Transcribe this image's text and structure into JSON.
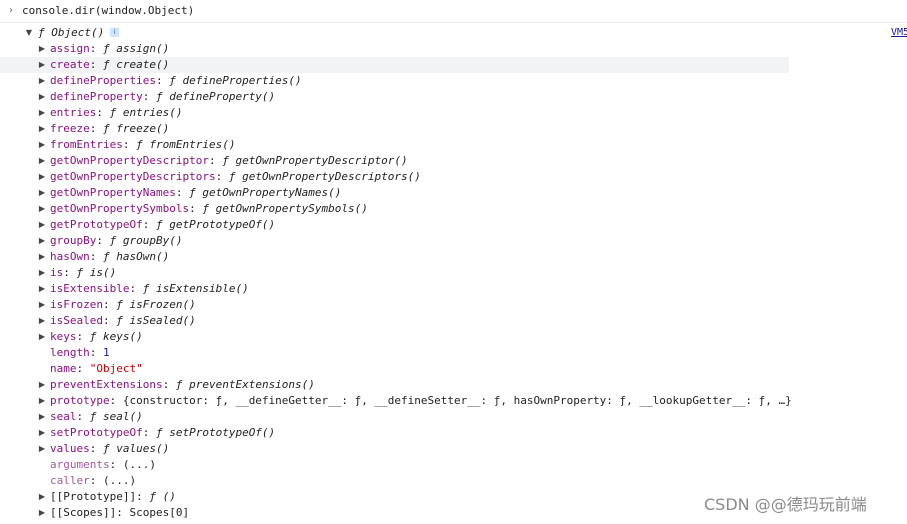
{
  "command": {
    "prompt_icon": "chevron-right-icon",
    "text": "console.dir(window.Object)"
  },
  "source_link": "VM5",
  "root": {
    "expand_icon": "triangle-down-icon",
    "f": "ƒ",
    "name": "Object()",
    "info_icon": "i"
  },
  "entries": [
    {
      "key": "assign",
      "kind": "fn",
      "f": "ƒ",
      "value": "assign()",
      "expandable": true,
      "dim": false
    },
    {
      "key": "create",
      "kind": "fn",
      "f": "ƒ",
      "value": "create()",
      "expandable": true,
      "dim": false,
      "hover": true
    },
    {
      "key": "defineProperties",
      "kind": "fn",
      "f": "ƒ",
      "value": "defineProperties()",
      "expandable": true,
      "dim": false
    },
    {
      "key": "defineProperty",
      "kind": "fn",
      "f": "ƒ",
      "value": "defineProperty()",
      "expandable": true,
      "dim": false
    },
    {
      "key": "entries",
      "kind": "fn",
      "f": "ƒ",
      "value": "entries()",
      "expandable": true,
      "dim": false
    },
    {
      "key": "freeze",
      "kind": "fn",
      "f": "ƒ",
      "value": "freeze()",
      "expandable": true,
      "dim": false
    },
    {
      "key": "fromEntries",
      "kind": "fn",
      "f": "ƒ",
      "value": "fromEntries()",
      "expandable": true,
      "dim": false
    },
    {
      "key": "getOwnPropertyDescriptor",
      "kind": "fn",
      "f": "ƒ",
      "value": "getOwnPropertyDescriptor()",
      "expandable": true,
      "dim": false
    },
    {
      "key": "getOwnPropertyDescriptors",
      "kind": "fn",
      "f": "ƒ",
      "value": "getOwnPropertyDescriptors()",
      "expandable": true,
      "dim": false
    },
    {
      "key": "getOwnPropertyNames",
      "kind": "fn",
      "f": "ƒ",
      "value": "getOwnPropertyNames()",
      "expandable": true,
      "dim": false
    },
    {
      "key": "getOwnPropertySymbols",
      "kind": "fn",
      "f": "ƒ",
      "value": "getOwnPropertySymbols()",
      "expandable": true,
      "dim": false
    },
    {
      "key": "getPrototypeOf",
      "kind": "fn",
      "f": "ƒ",
      "value": "getPrototypeOf()",
      "expandable": true,
      "dim": false
    },
    {
      "key": "groupBy",
      "kind": "fn",
      "f": "ƒ",
      "value": "groupBy()",
      "expandable": true,
      "dim": false
    },
    {
      "key": "hasOwn",
      "kind": "fn",
      "f": "ƒ",
      "value": "hasOwn()",
      "expandable": true,
      "dim": false
    },
    {
      "key": "is",
      "kind": "fn",
      "f": "ƒ",
      "value": "is()",
      "expandable": true,
      "dim": false
    },
    {
      "key": "isExtensible",
      "kind": "fn",
      "f": "ƒ",
      "value": "isExtensible()",
      "expandable": true,
      "dim": false
    },
    {
      "key": "isFrozen",
      "kind": "fn",
      "f": "ƒ",
      "value": "isFrozen()",
      "expandable": true,
      "dim": false
    },
    {
      "key": "isSealed",
      "kind": "fn",
      "f": "ƒ",
      "value": "isSealed()",
      "expandable": true,
      "dim": false
    },
    {
      "key": "keys",
      "kind": "fn",
      "f": "ƒ",
      "value": "keys()",
      "expandable": true,
      "dim": false
    },
    {
      "key": "length",
      "kind": "num",
      "value": "1",
      "expandable": false,
      "dim": false
    },
    {
      "key": "name",
      "kind": "str",
      "value": "\"Object\"",
      "expandable": false,
      "dim": false
    },
    {
      "key": "preventExtensions",
      "kind": "fn",
      "f": "ƒ",
      "value": "preventExtensions()",
      "expandable": true,
      "dim": false
    },
    {
      "key": "prototype",
      "kind": "plain",
      "value": "{constructor: ƒ, __defineGetter__: ƒ, __defineSetter__: ƒ, hasOwnProperty: ƒ, __lookupGetter__: ƒ, …}",
      "expandable": true,
      "dim": false
    },
    {
      "key": "seal",
      "kind": "fn",
      "f": "ƒ",
      "value": "seal()",
      "expandable": true,
      "dim": false
    },
    {
      "key": "setPrototypeOf",
      "kind": "fn",
      "f": "ƒ",
      "value": "setPrototypeOf()",
      "expandable": true,
      "dim": false
    },
    {
      "key": "values",
      "kind": "fn",
      "f": "ƒ",
      "value": "values()",
      "expandable": true,
      "dim": false
    },
    {
      "key": "arguments",
      "kind": "plain",
      "value": "(...)",
      "expandable": false,
      "dim": true
    },
    {
      "key": "caller",
      "kind": "plain",
      "value": "(...)",
      "expandable": false,
      "dim": true
    },
    {
      "key": "[[Prototype]]",
      "kind": "fn",
      "f": "ƒ",
      "value": "()",
      "expandable": true,
      "dim": false,
      "internal": true
    },
    {
      "key": "[[Scopes]]",
      "kind": "plain",
      "value": "Scopes[0]",
      "expandable": true,
      "dim": false,
      "internal": true
    }
  ],
  "watermark": "CSDN @@德玛玩前端"
}
